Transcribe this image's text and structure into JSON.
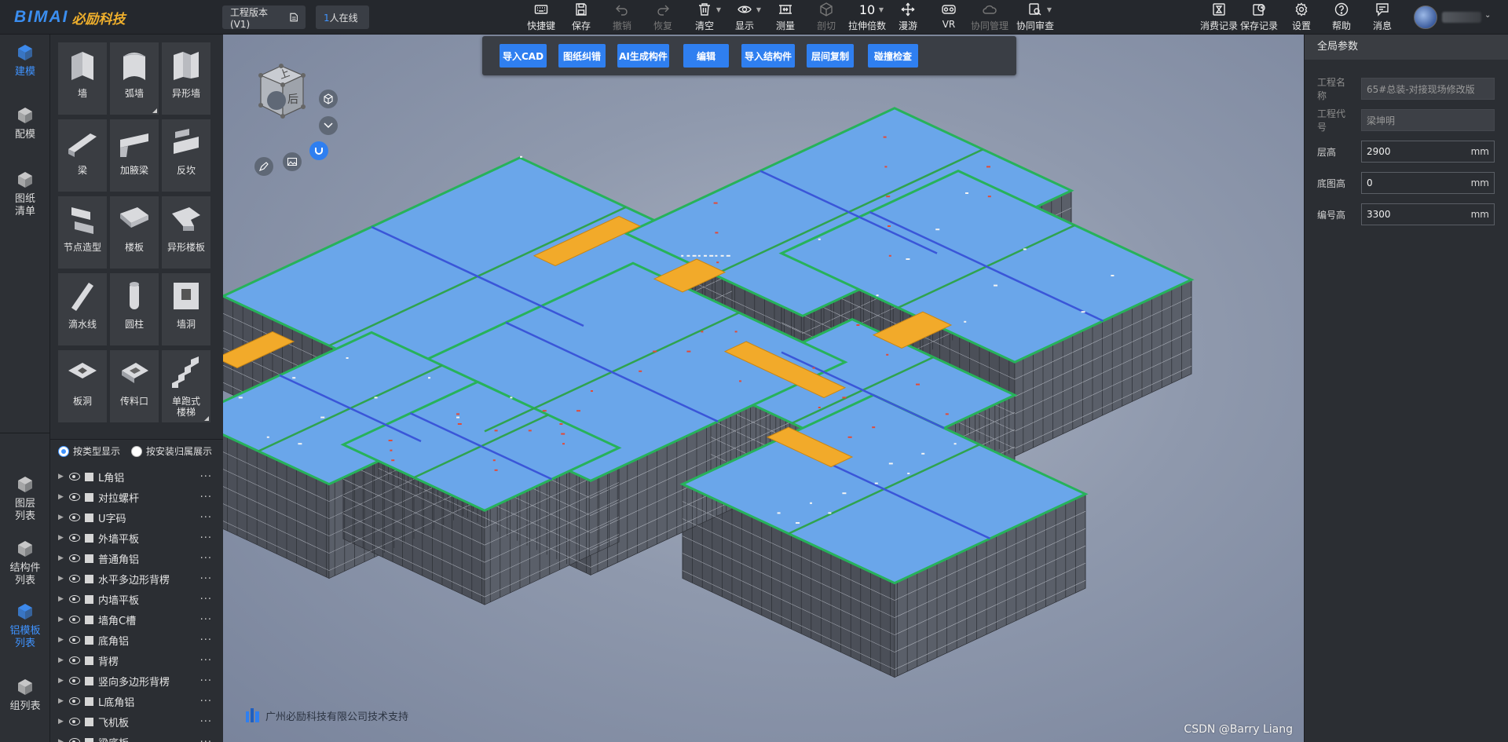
{
  "header": {
    "logo_text": "BIMAI",
    "logo_cn": "必励科技",
    "version_label": "工程版本(V1)",
    "online_count": "1",
    "online_label": "人在线"
  },
  "toolbar": [
    {
      "id": "shortcut",
      "label": "快捷键",
      "icon": "keyboard-icon",
      "enabled": true
    },
    {
      "id": "save",
      "label": "保存",
      "icon": "save-icon",
      "enabled": true
    },
    {
      "id": "undo",
      "label": "撤销",
      "icon": "undo-icon",
      "enabled": false
    },
    {
      "id": "redo",
      "label": "恢复",
      "icon": "redo-icon",
      "enabled": false
    },
    {
      "id": "clear",
      "label": "清空",
      "icon": "trash-icon",
      "enabled": true
    },
    {
      "id": "display",
      "label": "显示",
      "icon": "eye-icon",
      "enabled": true
    },
    {
      "id": "measure",
      "label": "测量",
      "icon": "ruler-icon",
      "enabled": true
    },
    {
      "id": "section",
      "label": "剖切",
      "icon": "cube-cut-icon",
      "enabled": false
    },
    {
      "id": "stretch",
      "label": "拉伸倍数",
      "icon": "stretch-number",
      "value": "10",
      "enabled": true
    },
    {
      "id": "roam",
      "label": "漫游",
      "icon": "move-icon",
      "enabled": true
    },
    {
      "id": "vr",
      "label": "VR",
      "icon": "vr-icon",
      "enabled": true
    },
    {
      "id": "collab",
      "label": "协同管理",
      "icon": "cloud-icon",
      "enabled": false
    },
    {
      "id": "review",
      "label": "协同审查",
      "icon": "review-icon",
      "enabled": true
    }
  ],
  "toolbar_right": [
    {
      "id": "consume",
      "label": "消费记录",
      "icon": "hourglass-icon"
    },
    {
      "id": "saverec",
      "label": "保存记录",
      "icon": "history-icon"
    },
    {
      "id": "settings",
      "label": "设置",
      "icon": "gear-icon"
    },
    {
      "id": "help",
      "label": "帮助",
      "icon": "help-icon"
    },
    {
      "id": "message",
      "label": "消息",
      "icon": "message-icon"
    }
  ],
  "rail": [
    {
      "label": "建模",
      "active": true
    },
    {
      "label": "配模",
      "active": false
    },
    {
      "label": "图纸\n清单",
      "active": false
    },
    {
      "label": "图层\n列表",
      "active": false
    },
    {
      "label": "结构件\n列表",
      "active": false
    },
    {
      "label": "铝模板\n列表",
      "active": true
    },
    {
      "label": "组列表",
      "active": false
    }
  ],
  "palette": [
    {
      "label": "墙",
      "shape": "wall"
    },
    {
      "label": "弧墙",
      "shape": "arc-wall",
      "more": true
    },
    {
      "label": "异形墙",
      "shape": "special-wall"
    },
    {
      "label": "梁",
      "shape": "beam"
    },
    {
      "label": "加腋梁",
      "shape": "haunch-beam"
    },
    {
      "label": "反坎",
      "shape": "curb"
    },
    {
      "label": "节点造型",
      "shape": "node"
    },
    {
      "label": "楼板",
      "shape": "slab"
    },
    {
      "label": "异形楼板",
      "shape": "special-slab"
    },
    {
      "label": "滴水线",
      "shape": "drip"
    },
    {
      "label": "圆柱",
      "shape": "column"
    },
    {
      "label": "墙洞",
      "shape": "wall-hole"
    },
    {
      "label": "板洞",
      "shape": "slab-hole"
    },
    {
      "label": "传料口",
      "shape": "feed"
    },
    {
      "label": "单跑式\n楼梯",
      "shape": "stair",
      "more": true
    }
  ],
  "layers": {
    "radio_type": "按类型显示",
    "radio_floor": "按安装归属展示",
    "items": [
      "L角铝",
      "对拉螺杆",
      "U字码",
      "外墙平板",
      "普通角铝",
      "水平多边形背楞",
      "内墙平板",
      "墙角C槽",
      "底角铝",
      "背楞",
      "竖向多边形背楞",
      "L底角铝",
      "飞机板",
      "梁底板"
    ]
  },
  "ribbon": [
    "导入CAD",
    "图纸纠错",
    "AI生成构件",
    "编辑",
    "导入结构件",
    "层间复制",
    "碰撞检查"
  ],
  "viewcube": {
    "top": "上",
    "front": "后"
  },
  "footer": "广州必励科技有限公司技术支持",
  "watermark": "CSDN @Barry Liang",
  "right_panel": {
    "title": "全局参数",
    "fields": [
      {
        "label": "工程名称",
        "value": "65#总装-对接现场修改版",
        "unit": "",
        "disabled": true
      },
      {
        "label": "工程代号",
        "value": "梁坤明",
        "unit": "",
        "disabled": true
      },
      {
        "label": "层高",
        "value": "2900",
        "unit": "mm",
        "disabled": false
      },
      {
        "label": "底图高",
        "value": "0",
        "unit": "mm",
        "disabled": false
      },
      {
        "label": "编号高",
        "value": "3300",
        "unit": "mm",
        "disabled": false
      }
    ]
  }
}
